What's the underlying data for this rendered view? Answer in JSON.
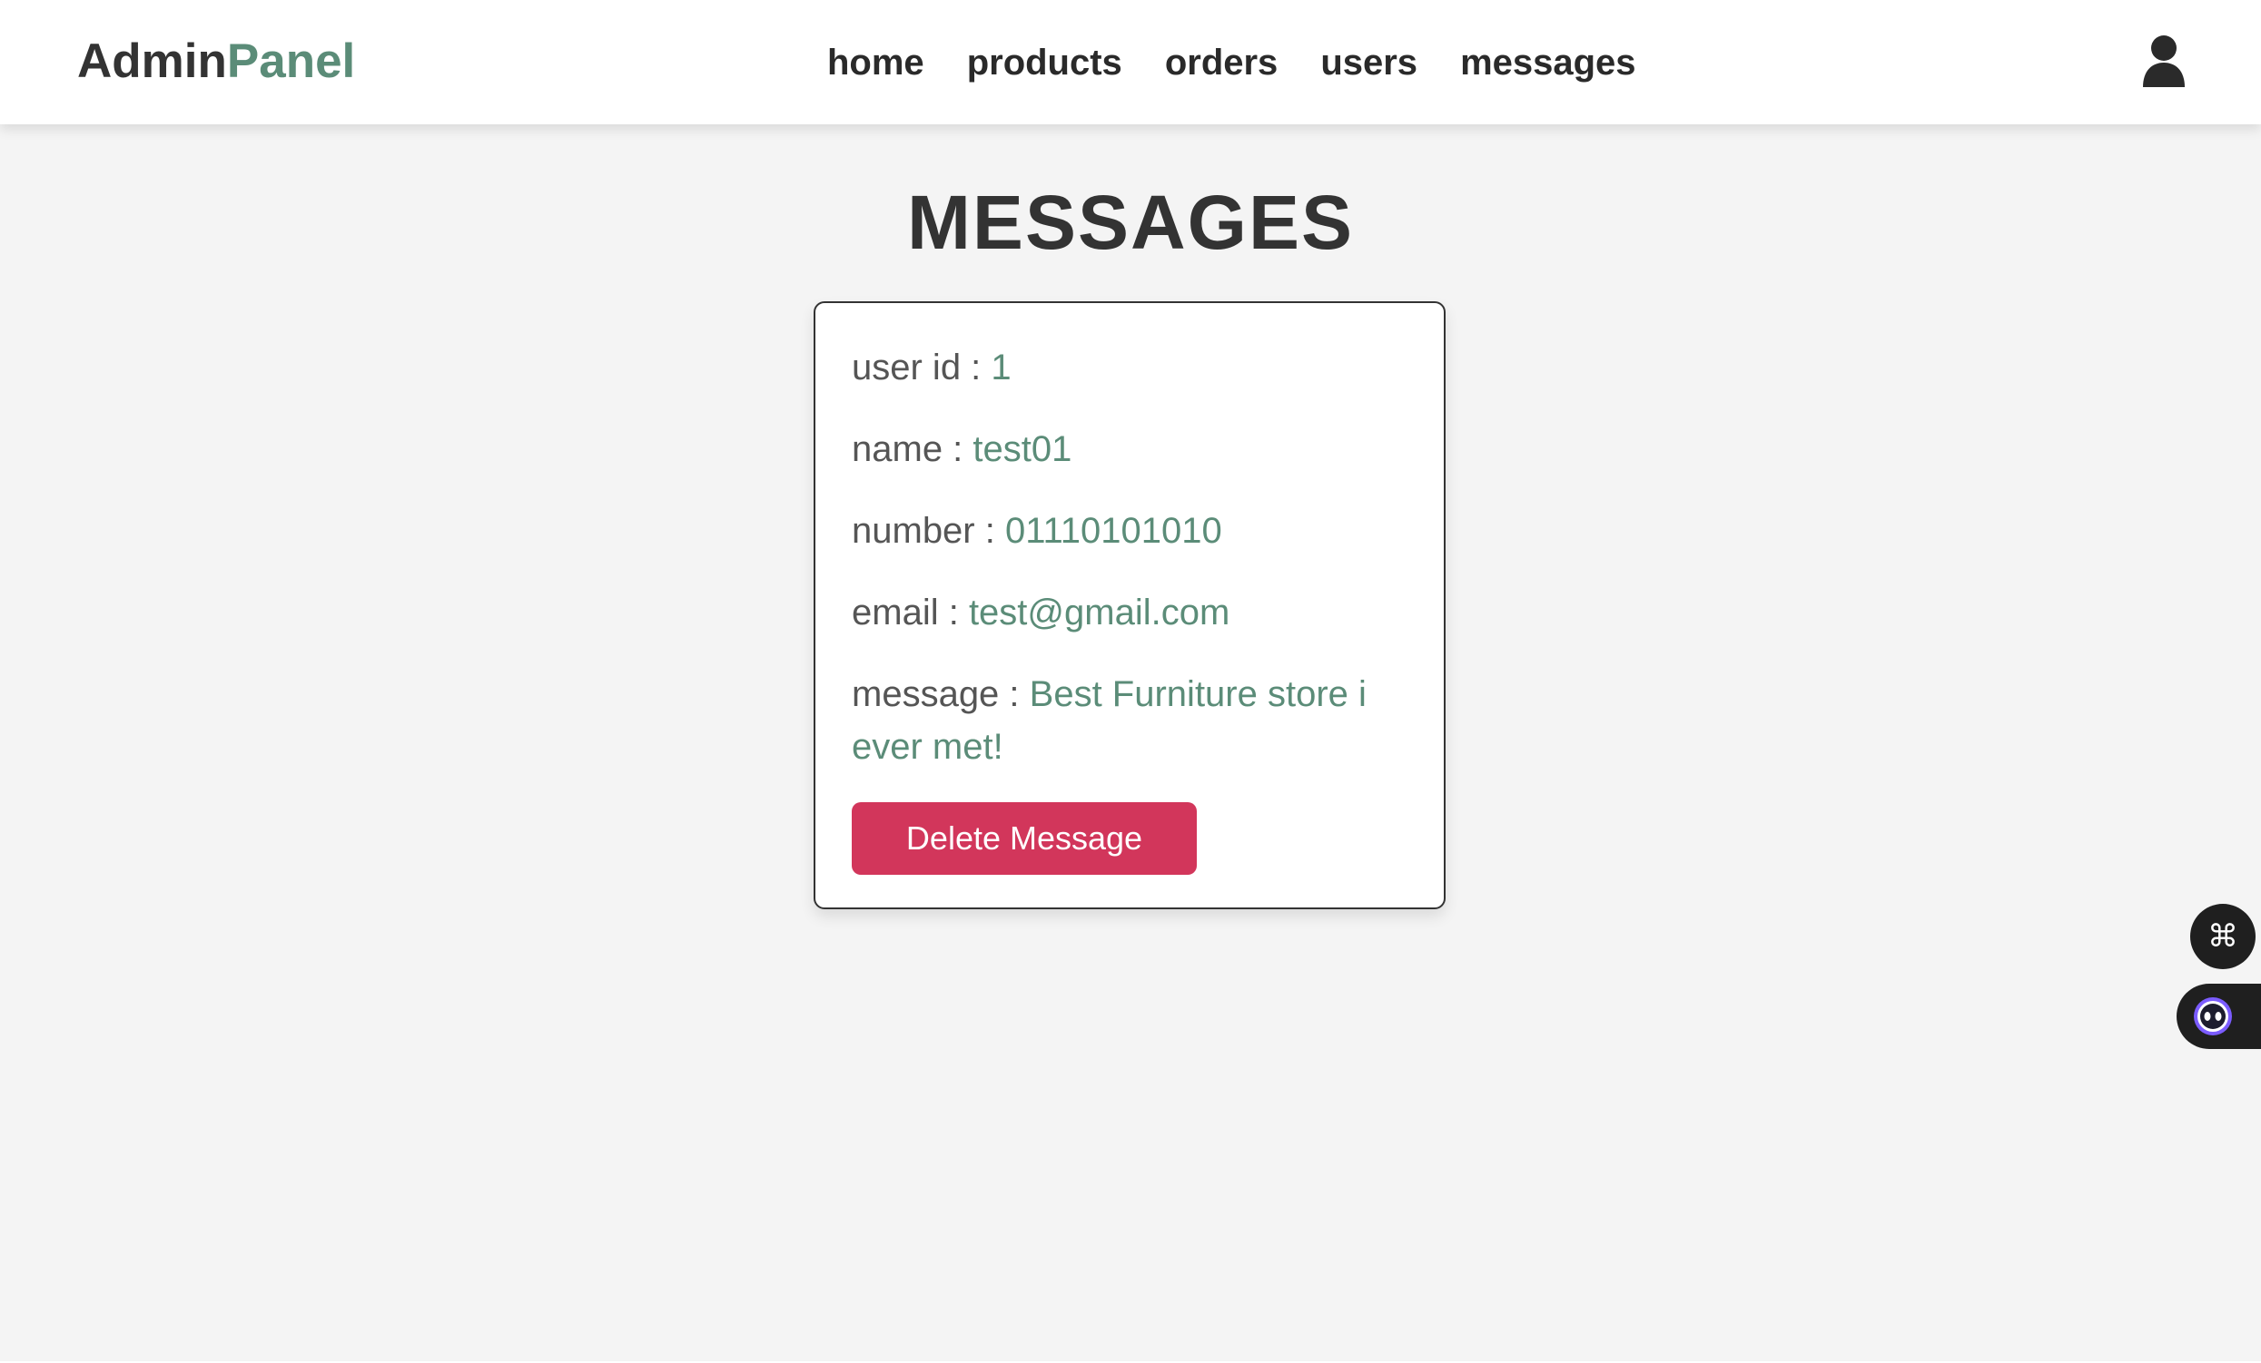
{
  "header": {
    "logo_primary": "Admin",
    "logo_accent": "Panel",
    "nav": [
      {
        "label": "home"
      },
      {
        "label": "products"
      },
      {
        "label": "orders"
      },
      {
        "label": "users"
      },
      {
        "label": "messages"
      }
    ],
    "user_icon": "user-icon"
  },
  "page": {
    "title": "MESSAGES"
  },
  "message": {
    "user_id_label": "user id : ",
    "user_id": "1",
    "name_label": "name : ",
    "name": "test01",
    "number_label": "number : ",
    "number": "01110101010",
    "email_label": "email : ",
    "email": "test@gmail.com",
    "message_label": "message : ",
    "message": "Best Furniture store i ever met!",
    "delete_label": "Delete Message"
  },
  "floating": {
    "command_icon": "command-icon",
    "assistant_icon": "assistant-face-icon"
  },
  "colors": {
    "accent": "#5b8c78",
    "danger": "#d2365b",
    "text_dark": "#333333",
    "background": "#f4f4f4"
  }
}
